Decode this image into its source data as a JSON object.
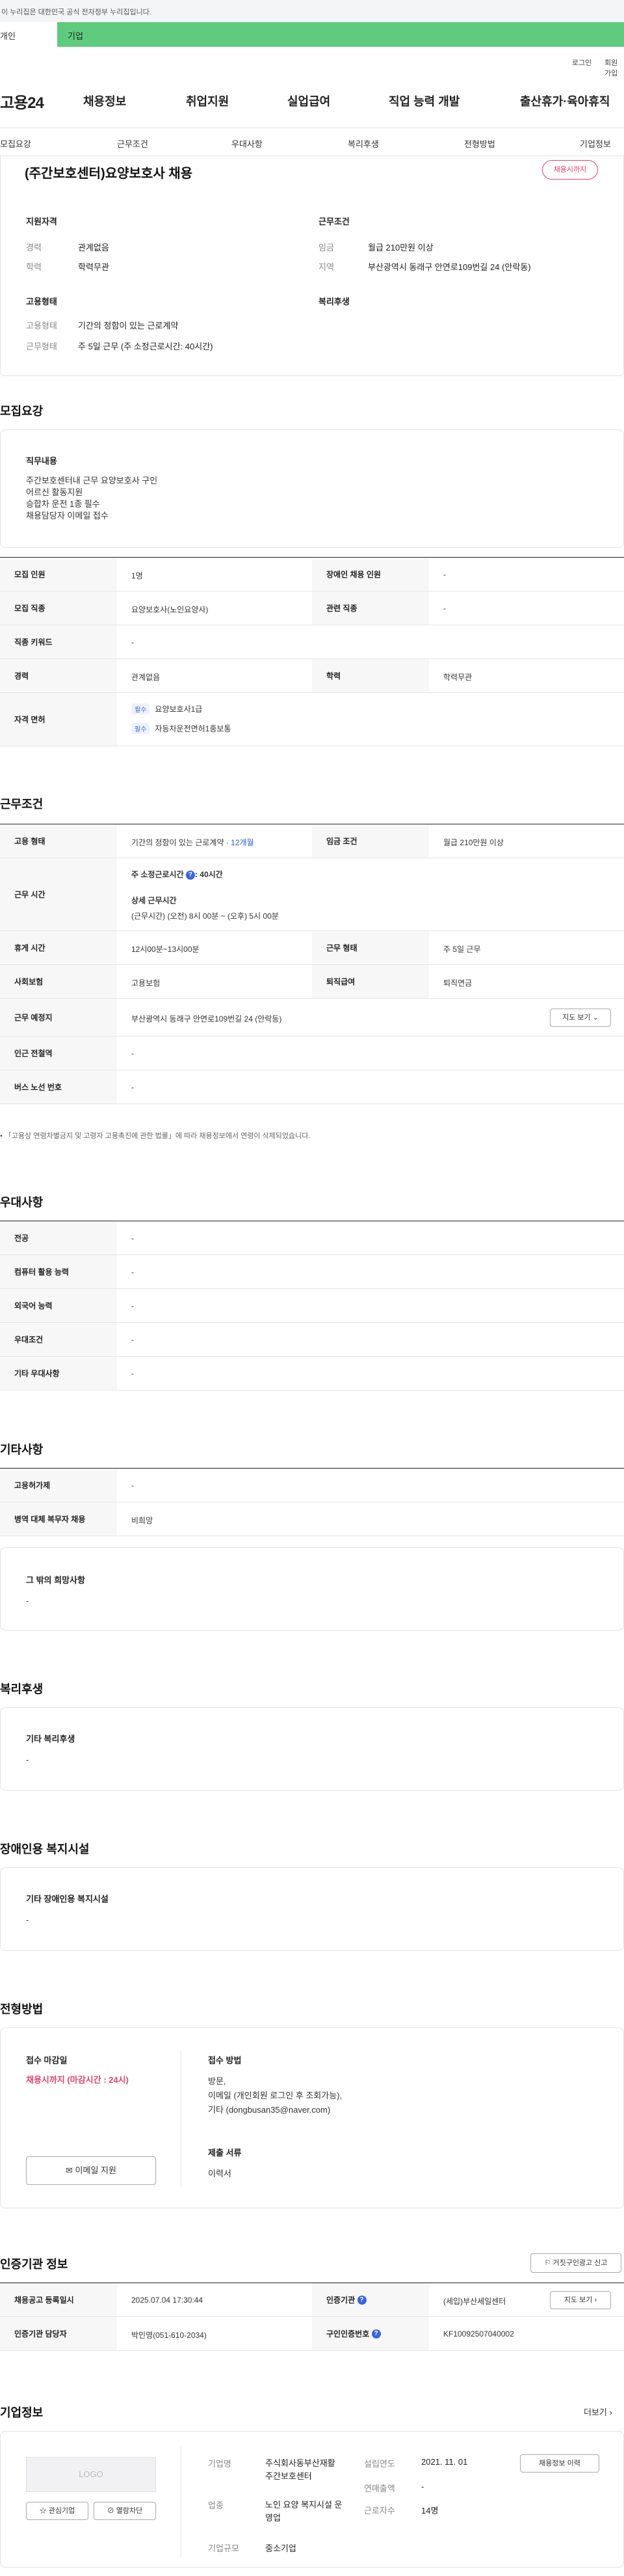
{
  "gov_banner": {
    "text": "이 누리집은 대한민국 공식 전자정부 누리집입니다."
  },
  "gnb_tabs": [
    "개인",
    "기업"
  ],
  "util_links": [
    "로그인",
    "회원가입"
  ],
  "logo": {
    "text": "고용24"
  },
  "main_menu": [
    "채용정보",
    "취업지원",
    "실업급여",
    "직업 능력 개발",
    "출산휴가·육아휴직"
  ],
  "tabs": [
    "모집요강",
    "근무조건",
    "우대사항",
    "복리후생",
    "전형방법",
    "기업정보"
  ],
  "job": {
    "title": "(주간보호센터)요양보호사 채용",
    "deadline_badge": "채용시까지",
    "summary": {
      "qual_title": "지원자격",
      "career_label": "경력",
      "career_value": "관계없음",
      "edu_label": "학력",
      "edu_value": "학력무관",
      "emp_title": "고용형태",
      "emp_label": "고용형태",
      "emp_value": "기간의 정함이 있는 근로계약",
      "worktype_label": "근무형태",
      "worktype_value": "주 5일 근무 (주 소정근로시간: 40시간)",
      "cond_title": "근무조건",
      "wage_label": "임금",
      "wage_value": "월급 210만원 이상",
      "region_label": "지역",
      "region_value": "부산광역시 동래구 안연로109번길 24 (안락동)",
      "welfare_title": "복리후생"
    }
  },
  "recruit": {
    "heading": "모집요강",
    "duty_title": "직무내용",
    "duty_lines": [
      "주간보호센터내 근무 요양보호사 구인",
      "어르신 활동지원",
      "승합차 운전 1종 필수",
      "채용담당자 이메일 접수"
    ],
    "rows": {
      "count_label": "모집 인원",
      "count_value": "1명",
      "disabled_label": "장애인 채용 인원",
      "disabled_value": "-",
      "job_label": "모집 직종",
      "job_value": "요양보호사(노인요양사)",
      "related_label": "관련 직종",
      "related_value": "-",
      "keyword_label": "직종 키워드",
      "keyword_value": "-",
      "career_label": "경력",
      "career_value": "관계없음",
      "edu_label": "학력",
      "edu_value": "학력무관",
      "license_label": "자격 면허",
      "licenses": [
        {
          "badge": "필수",
          "name": "요양보호사1급"
        },
        {
          "badge": "필수",
          "name": "자동차운전면허1종보통"
        }
      ]
    }
  },
  "work": {
    "heading": "근무조건",
    "emp_label": "고용 형태",
    "emp_value": "기간의 정함이 있는 근로계약 · ",
    "emp_months": "12개월",
    "wage_label": "임금 조건",
    "wage_value": "월급 210만원 이상",
    "hours_label": "근무 시간",
    "hours_week": "주 소정근로시간",
    "hours_week_value": ": 40시간",
    "hours_detail_title": "상세 근무시간",
    "hours_detail": "(근무시간) (오전) 8시 00분 ~ (오후) 5시 00분",
    "break_label": "휴게 시간",
    "break_value": "12시00분~13시00분",
    "form_label": "근무 형태",
    "form_value": "주 5일 근무",
    "ins_label": "사회보험",
    "ins_value": "고용보험",
    "retire_label": "퇴직급여",
    "retire_value": "퇴직연금",
    "place_label": "근무 예정지",
    "place_value": "부산광역시 동래구 안연로109번길 24 (안락동)",
    "map_btn": "지도 보기",
    "subway_label": "인근 전철역",
    "subway_value": "-",
    "bus_label": "버스 노선 번호",
    "bus_value": "-",
    "note": "「고용상 연령차별금지 및 고령자 고용촉진에 관한 법률」에 따라 채용정보에서 연령이 삭제되었습니다."
  },
  "pref": {
    "heading": "우대사항",
    "rows": [
      {
        "label": "전공",
        "value": "-"
      },
      {
        "label": "컴퓨터 활용 능력",
        "value": "-"
      },
      {
        "label": "외국어 능력",
        "value": "-"
      },
      {
        "label": "우대조건",
        "value": "-"
      },
      {
        "label": "기타 우대사항",
        "value": "-"
      }
    ]
  },
  "etc": {
    "heading": "기타사항",
    "rows": [
      {
        "label": "고용허가제",
        "value": "-"
      },
      {
        "label": "병역 대체 복무자 채용",
        "value": "비희망"
      }
    ],
    "wish_title": "그 밖의 희망사항",
    "wish_value": "-"
  },
  "welfare": {
    "heading": "복리후생",
    "title": "기타 복리후생",
    "value": "-"
  },
  "disabled_fac": {
    "heading": "장애인용 복지시설",
    "title": "기타 장애인용 복지시설",
    "value": "-"
  },
  "selection": {
    "heading": "전형방법",
    "deadline_title": "접수 마감일",
    "deadline_value": "채용시까지 (마감시간 : 24시)",
    "email_btn": "이메일 지원",
    "method_title": "접수 방법",
    "method_lines": [
      "방문,",
      "이메일 (개인회원 로그인 후 조회가능),",
      "기타 (dongbusan35@naver.com)"
    ],
    "docs_title": "제출 서류",
    "docs_value": "이력서"
  },
  "cert": {
    "heading": "인증기관 정보",
    "report_btn": "거짓구인광고 신고",
    "reg_label": "채용공고 등록일시",
    "reg_value": "2025.07.04 17:30:44",
    "agency_label": "인증기관",
    "agency_value": "(세입)부산세일센터",
    "map_btn": "지도 보기",
    "manager_label": "인증기관 담당자",
    "manager_value": "박인영(051-610-2034)",
    "certno_label": "구인인증번호",
    "certno_value": "KF10092507040002"
  },
  "company": {
    "heading": "기업정보",
    "more": "더보기",
    "logo_text": "LOGO",
    "fav_btn": "관심기업",
    "block_btn": "열람차단",
    "name_label": "기업명",
    "name_value": "주식회사동부산재활주간보호센터",
    "founded_label": "설립연도",
    "founded_value": "2021. 11. 01",
    "sales_label": "연매출액",
    "sales_value": "-",
    "industry_label": "업종",
    "industry_value": "노인 요양 복지시설 운영업",
    "employees_label": "근로자수",
    "employees_value": "14명",
    "size_label": "기업규모",
    "size_value": "중소기업",
    "jobs_btn": "채용정보 이력"
  },
  "colors": {
    "green": "#5fcb7e",
    "accent_red": "#e5426a",
    "link_blue": "#1f5be6"
  }
}
